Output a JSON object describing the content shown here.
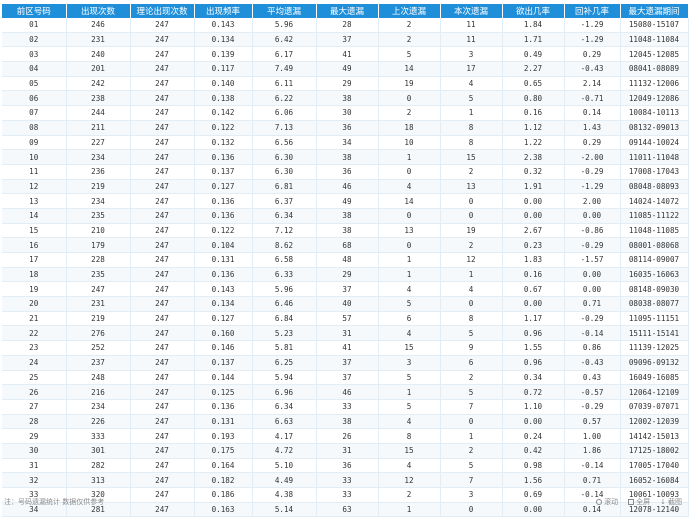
{
  "table": {
    "headers": [
      "前区号码",
      "出现次数",
      "理论出现次数",
      "出现频率",
      "平均遗漏",
      "最大遗漏",
      "上次遗漏",
      "本次遗漏",
      "欲出几率",
      "回补几率",
      "最大遗漏期间"
    ],
    "rows": [
      [
        "01",
        "246",
        "247",
        "0.143",
        "5.96",
        "28",
        "2",
        "11",
        "1.84",
        "-1.29",
        "15080-15107"
      ],
      [
        "02",
        "231",
        "247",
        "0.134",
        "6.42",
        "37",
        "2",
        "11",
        "1.71",
        "-1.29",
        "11048-11084"
      ],
      [
        "03",
        "240",
        "247",
        "0.139",
        "6.17",
        "41",
        "5",
        "3",
        "0.49",
        "0.29",
        "12045-12085"
      ],
      [
        "04",
        "201",
        "247",
        "0.117",
        "7.49",
        "49",
        "14",
        "17",
        "2.27",
        "-0.43",
        "08041-08089"
      ],
      [
        "05",
        "242",
        "247",
        "0.140",
        "6.11",
        "29",
        "19",
        "4",
        "0.65",
        "2.14",
        "11132-12006"
      ],
      [
        "06",
        "238",
        "247",
        "0.138",
        "6.22",
        "38",
        "0",
        "5",
        "0.80",
        "-0.71",
        "12049-12086"
      ],
      [
        "07",
        "244",
        "247",
        "0.142",
        "6.06",
        "30",
        "2",
        "1",
        "0.16",
        "0.14",
        "10084-10113"
      ],
      [
        "08",
        "211",
        "247",
        "0.122",
        "7.13",
        "36",
        "18",
        "8",
        "1.12",
        "1.43",
        "08132-09013"
      ],
      [
        "09",
        "227",
        "247",
        "0.132",
        "6.56",
        "34",
        "10",
        "8",
        "1.22",
        "0.29",
        "09144-10024"
      ],
      [
        "10",
        "234",
        "247",
        "0.136",
        "6.30",
        "38",
        "1",
        "15",
        "2.38",
        "-2.00",
        "11011-11048"
      ],
      [
        "11",
        "236",
        "247",
        "0.137",
        "6.30",
        "36",
        "0",
        "2",
        "0.32",
        "-0.29",
        "17008-17043"
      ],
      [
        "12",
        "219",
        "247",
        "0.127",
        "6.81",
        "46",
        "4",
        "13",
        "1.91",
        "-1.29",
        "08048-08093"
      ],
      [
        "13",
        "234",
        "247",
        "0.136",
        "6.37",
        "49",
        "14",
        "0",
        "0.00",
        "2.00",
        "14024-14072"
      ],
      [
        "14",
        "235",
        "247",
        "0.136",
        "6.34",
        "38",
        "0",
        "0",
        "0.00",
        "0.00",
        "11085-11122"
      ],
      [
        "15",
        "210",
        "247",
        "0.122",
        "7.12",
        "38",
        "13",
        "19",
        "2.67",
        "-0.86",
        "11048-11085"
      ],
      [
        "16",
        "179",
        "247",
        "0.104",
        "8.62",
        "68",
        "0",
        "2",
        "0.23",
        "-0.29",
        "08001-08068"
      ],
      [
        "17",
        "228",
        "247",
        "0.131",
        "6.58",
        "48",
        "1",
        "12",
        "1.83",
        "-1.57",
        "08114-09007"
      ],
      [
        "18",
        "235",
        "247",
        "0.136",
        "6.33",
        "29",
        "1",
        "1",
        "0.16",
        "0.00",
        "16035-16063"
      ],
      [
        "19",
        "247",
        "247",
        "0.143",
        "5.96",
        "37",
        "4",
        "4",
        "0.67",
        "0.00",
        "08148-09030"
      ],
      [
        "20",
        "231",
        "247",
        "0.134",
        "6.46",
        "40",
        "5",
        "0",
        "0.00",
        "0.71",
        "08038-08077"
      ],
      [
        "21",
        "219",
        "247",
        "0.127",
        "6.84",
        "57",
        "6",
        "8",
        "1.17",
        "-0.29",
        "11095-11151"
      ],
      [
        "22",
        "276",
        "247",
        "0.160",
        "5.23",
        "31",
        "4",
        "5",
        "0.96",
        "-0.14",
        "15111-15141"
      ],
      [
        "23",
        "252",
        "247",
        "0.146",
        "5.81",
        "41",
        "15",
        "9",
        "1.55",
        "0.86",
        "11139-12025"
      ],
      [
        "24",
        "237",
        "247",
        "0.137",
        "6.25",
        "37",
        "3",
        "6",
        "0.96",
        "-0.43",
        "09096-09132"
      ],
      [
        "25",
        "248",
        "247",
        "0.144",
        "5.94",
        "37",
        "5",
        "2",
        "0.34",
        "0.43",
        "16049-16085"
      ],
      [
        "26",
        "216",
        "247",
        "0.125",
        "6.96",
        "46",
        "1",
        "5",
        "0.72",
        "-0.57",
        "12064-12109"
      ],
      [
        "27",
        "234",
        "247",
        "0.136",
        "6.34",
        "33",
        "5",
        "7",
        "1.10",
        "-0.29",
        "07039-07071"
      ],
      [
        "28",
        "226",
        "247",
        "0.131",
        "6.63",
        "38",
        "4",
        "0",
        "0.00",
        "0.57",
        "12002-12039"
      ],
      [
        "29",
        "333",
        "247",
        "0.193",
        "4.17",
        "26",
        "8",
        "1",
        "0.24",
        "1.00",
        "14142-15013"
      ],
      [
        "30",
        "301",
        "247",
        "0.175",
        "4.72",
        "31",
        "15",
        "2",
        "0.42",
        "1.86",
        "17125-18002"
      ],
      [
        "31",
        "282",
        "247",
        "0.164",
        "5.10",
        "36",
        "4",
        "5",
        "0.98",
        "-0.14",
        "17005-17040"
      ],
      [
        "32",
        "313",
        "247",
        "0.182",
        "4.49",
        "33",
        "12",
        "7",
        "1.56",
        "0.71",
        "16052-16084"
      ],
      [
        "33",
        "320",
        "247",
        "0.186",
        "4.38",
        "33",
        "2",
        "3",
        "0.69",
        "-0.14",
        "10061-10093"
      ],
      [
        "34",
        "281",
        "247",
        "0.163",
        "5.14",
        "63",
        "1",
        "0",
        "0.00",
        "0.14",
        "12078-12140"
      ]
    ]
  },
  "footer": {
    "left_text": "注：号码遗漏统计 数据仅供参考",
    "right_items": [
      "滚动",
      "全屏",
      "截图"
    ]
  },
  "colors": {
    "header_bg": "#1f8fd9",
    "header_text": "#ffffff",
    "cell_text": "#333333",
    "grid": "#e3edf5"
  }
}
